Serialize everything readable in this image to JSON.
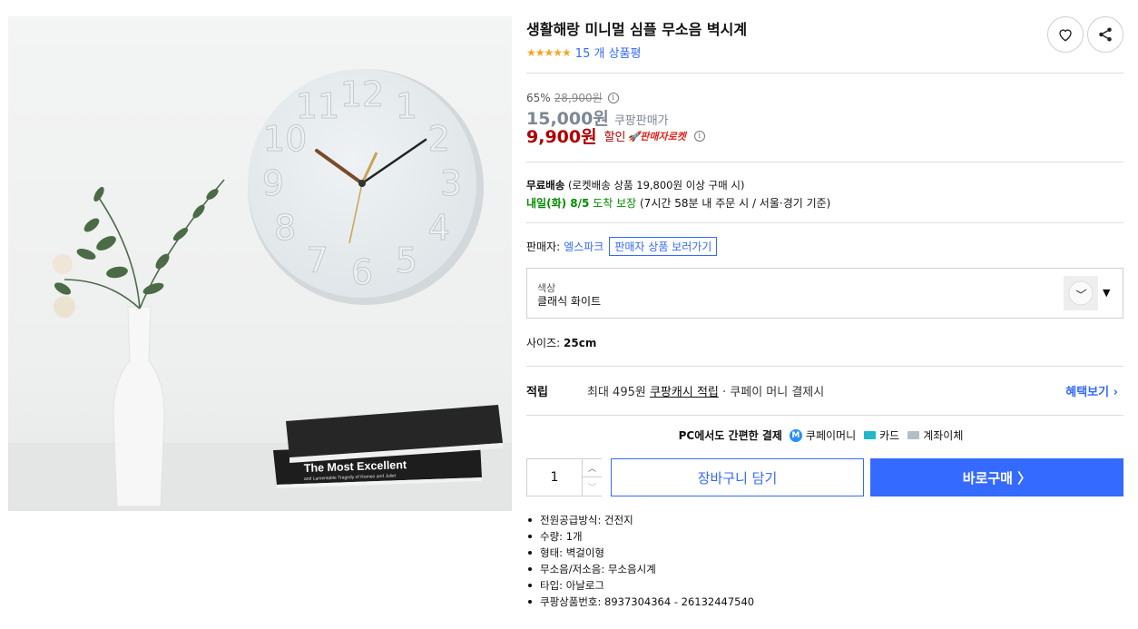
{
  "product": {
    "title": "생활해랑 미니멀 심플 무소음 벽시계",
    "stars": "★★★★★",
    "review_count": "15 개 상품평"
  },
  "actions": {
    "wishlist_icon": "heart-icon",
    "share_icon": "share-icon"
  },
  "price": {
    "discount_rate": "65%",
    "original_price": "28,900원",
    "sale_price": "15,000원",
    "sale_label": "쿠팡판매가",
    "coupon_price": "9,900원",
    "coupon_label": "할인",
    "rocket_badge": "🚀판매자로켓"
  },
  "shipping": {
    "free_label": "무료배송",
    "free_detail": "(로켓배송 상품 19,800원 이상 구매 시)",
    "arrival_day": "내일(화) 8/5",
    "arrival_label": "도착 보장",
    "arrival_detail": "(7시간 58분 내 주문 시 / 서울·경기 기준)"
  },
  "seller": {
    "label": "판매자:",
    "name": "엘스파크",
    "link": "판매자 상품 보러가기"
  },
  "option": {
    "label": "색상",
    "value": "클래식 화이트"
  },
  "size": {
    "label": "사이즈:",
    "value": "25cm"
  },
  "points": {
    "label": "적립",
    "prefix": "최대 495원",
    "cash": "쿠팡캐시 적립",
    "suffix": "· 쿠페이 머니 결제시",
    "benefit_link": "혜택보기 ›"
  },
  "payment": {
    "label": "PC에서도 간편한 결제",
    "methods": [
      "쿠페이머니",
      "카드",
      "계좌이체"
    ]
  },
  "purchase": {
    "quantity": "1",
    "cart_button": "장바구니 담기",
    "buy_button": "바로구매 〉"
  },
  "specs": [
    "전원공급방식: 건전지",
    "수량: 1개",
    "형태: 벽걸이형",
    "무소음/저소음: 무소음시계",
    "타입: 아날로그",
    "쿠팡상품번호: 8937304364 - 26132447540"
  ],
  "image": {
    "clock_numbers": [
      "12",
      "1",
      "2",
      "3",
      "4",
      "5",
      "6",
      "7",
      "8",
      "9",
      "10",
      "11"
    ],
    "book_title": "The Most Excellent",
    "book_subtitle": "and Lamentable Tragedy of Romeo and Juliet"
  }
}
